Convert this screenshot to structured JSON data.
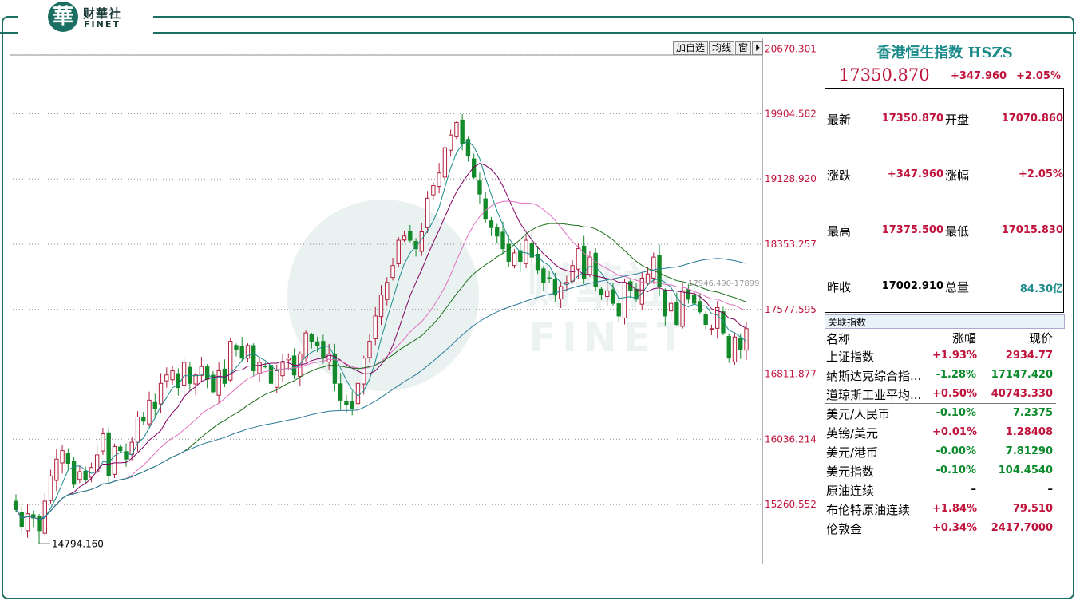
{
  "brand": {
    "cn": "财華社",
    "en": "FINET",
    "mark": "華"
  },
  "toolbar": [
    "加自选",
    "均线",
    "窗",
    "⏵"
  ],
  "quote": {
    "title": "香港恒生指数 HSZS",
    "price": "17350.870",
    "change": "+347.960",
    "pct": "+2.05%",
    "rows": [
      {
        "l1": "最新",
        "v1": "17350.870",
        "l2": "开盘",
        "v2": "17070.860"
      },
      {
        "l1": "涨跌",
        "v1": "+347.960",
        "l2": "涨幅",
        "v2": "+2.05%"
      },
      {
        "l1": "最高",
        "v1": "17375.500",
        "l2": "最低",
        "v2": "17015.830"
      },
      {
        "l1": "昨收",
        "v1": "17002.910",
        "l2": "总量",
        "v2": "84.30亿"
      }
    ]
  },
  "related": {
    "header": "关联指数",
    "cols": [
      "名称",
      "涨幅",
      "现价"
    ],
    "items": [
      {
        "name": "上证指数",
        "pct": "+1.93%",
        "price": "2934.77",
        "dir": "up"
      },
      {
        "name": "纳斯达克综合指...",
        "pct": "-1.28%",
        "price": "17147.420",
        "dir": "dn"
      },
      {
        "name": "道琼斯工业平均...",
        "pct": "+0.50%",
        "price": "40743.330",
        "dir": "up"
      },
      {
        "name": "美元/人民币",
        "pct": "-0.10%",
        "price": "7.2375",
        "dir": "dn"
      },
      {
        "name": "英镑/美元",
        "pct": "+0.01%",
        "price": "1.28408",
        "dir": "up"
      },
      {
        "name": "美元/港币",
        "pct": "-0.00%",
        "price": "7.81290",
        "dir": "dn"
      },
      {
        "name": "美元指数",
        "pct": "-0.10%",
        "price": "104.4540",
        "dir": "dn"
      },
      {
        "name": "原油连续",
        "pct": "–",
        "price": "–",
        "dir": "none"
      },
      {
        "name": "布伦特原油连续",
        "pct": "+1.84%",
        "price": "79.510",
        "dir": "up"
      },
      {
        "name": "伦敦金",
        "pct": "+0.34%",
        "price": "2417.7000",
        "dir": "up"
      }
    ]
  },
  "chart_data": {
    "type": "candlestick",
    "y_ticks": [
      "20670.301",
      "19904.582",
      "19128.920",
      "18353.257",
      "17577.595",
      "16811.877",
      "16036.214",
      "15260.552"
    ],
    "ylim": [
      14550,
      20800
    ],
    "annotations": {
      "low_label": "14794.160",
      "ma_readout": "17946.490-17899"
    },
    "closes": [
      15200,
      15000,
      15150,
      15100,
      14950,
      15300,
      15600,
      15800,
      15900,
      15750,
      15500,
      15650,
      15550,
      15700,
      15850,
      16100,
      15600,
      15950,
      15900,
      15800,
      16000,
      16300,
      16250,
      16500,
      16400,
      16700,
      16800,
      16850,
      16650,
      16950,
      16700,
      16800,
      16900,
      16750,
      16600,
      16850,
      16700,
      17200,
      17100,
      17000,
      17150,
      16850,
      16950,
      16900,
      16700,
      16850,
      16950,
      17000,
      16800,
      17050,
      17300,
      17200,
      17150,
      17000,
      17050,
      16700,
      16500,
      16450,
      16400,
      16700,
      17000,
      17200,
      17500,
      17750,
      17900,
      18100,
      18400,
      18450,
      18400,
      18300,
      18500,
      18900,
      19050,
      19200,
      19500,
      19650,
      19800,
      19550,
      19400,
      19150,
      18950,
      18650,
      18550,
      18450,
      18300,
      18150,
      18250,
      18150,
      18400,
      18200,
      18050,
      17900,
      17950,
      17750,
      17850,
      17900,
      18100,
      18300,
      17950,
      18200,
      17850,
      17750,
      17800,
      17650,
      17500,
      17900,
      17800,
      17700,
      17950,
      18000,
      18200,
      17850,
      17500,
      17650,
      17400,
      17800,
      17700,
      17650,
      17550,
      17400,
      17350,
      17600,
      17300,
      17000,
      17250,
      17100,
      17350
    ]
  }
}
